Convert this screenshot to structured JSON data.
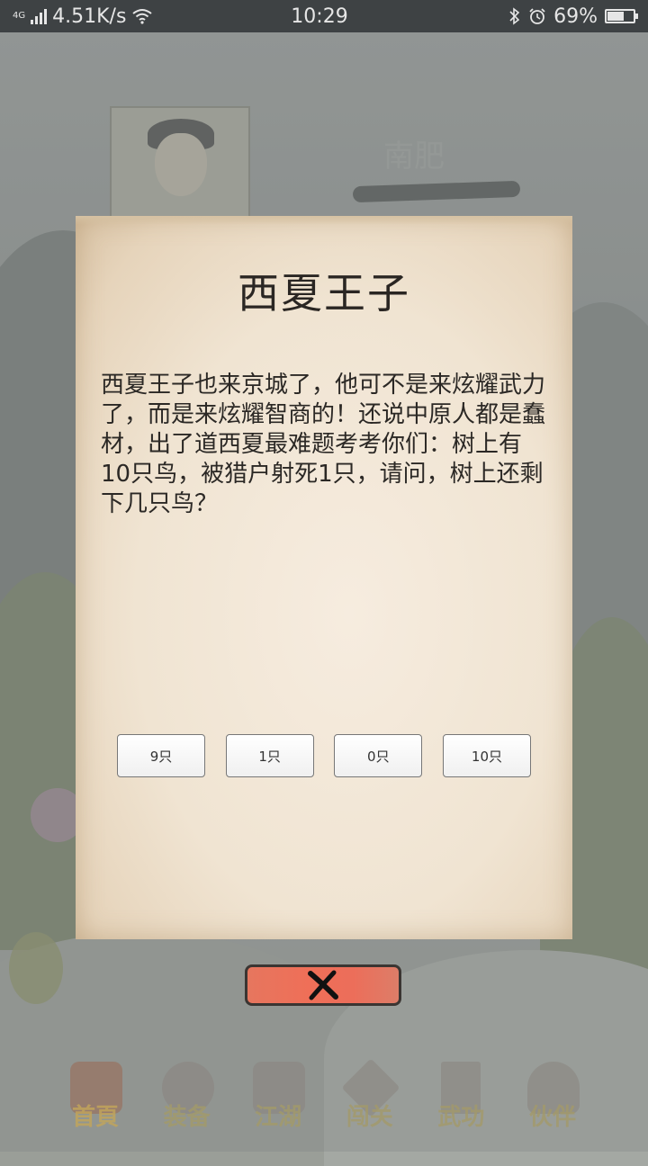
{
  "status_bar": {
    "network_type": "4G",
    "speed": "4.51K/s",
    "time": "10:29",
    "battery_percent": "69%",
    "battery_level": 0.69,
    "icons": [
      "signal-icon",
      "wifi-icon",
      "bluetooth-icon",
      "alarm-icon",
      "battery-icon"
    ]
  },
  "background": {
    "character_name": "南肥"
  },
  "dialog": {
    "title": "西夏王子",
    "body": "西夏王子也来京城了，他可不是来炫耀武力了，而是来炫耀智商的！还说中原人都是蠢材，出了道西夏最难题考考你们：树上有10只鸟，被猎户射死1只，请问，树上还剩下几只鸟？",
    "answers": [
      "9只",
      "1只",
      "0只",
      "10只"
    ]
  },
  "close_button": {
    "icon": "close-x-icon",
    "color": "#ec6e5a"
  },
  "bottom_nav": {
    "items": [
      {
        "label": "首頁",
        "icon": "home-icon"
      },
      {
        "label": "装备",
        "icon": "equipment-icon"
      },
      {
        "label": "江湖",
        "icon": "jianghu-icon"
      },
      {
        "label": "闯关",
        "icon": "challenge-icon"
      },
      {
        "label": "武功",
        "icon": "martial-arts-icon"
      },
      {
        "label": "伙伴",
        "icon": "partners-icon"
      }
    ],
    "active_index": 0
  }
}
